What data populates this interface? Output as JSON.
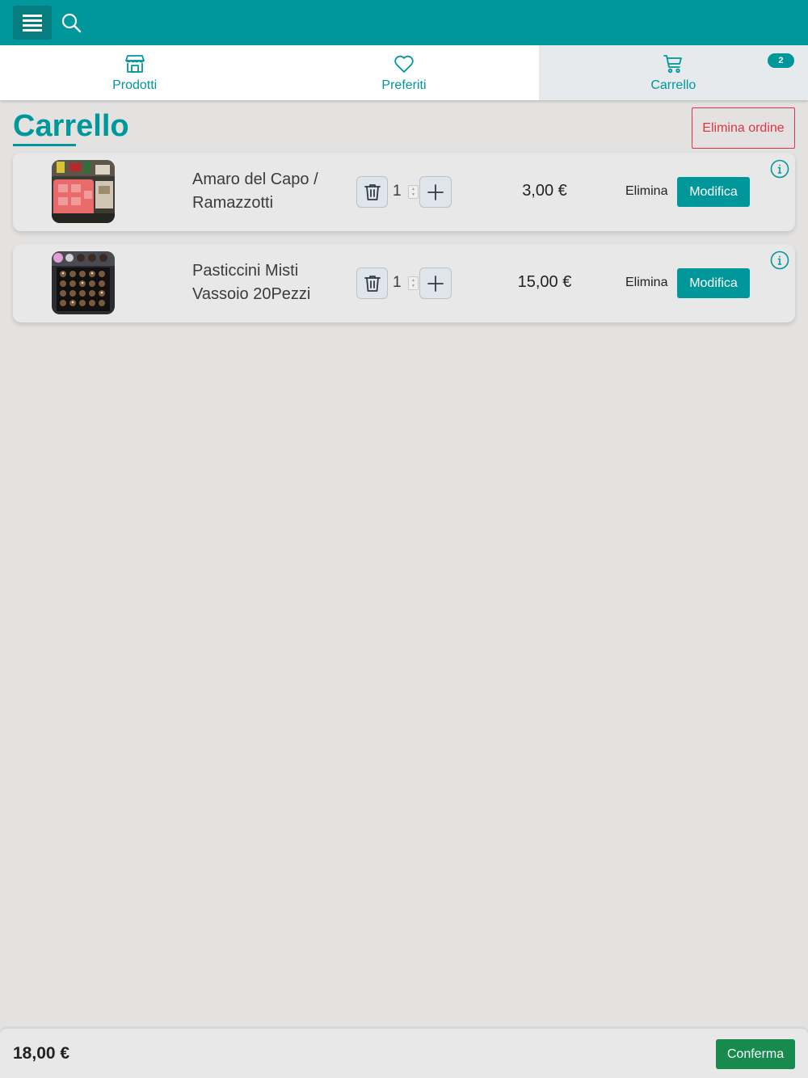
{
  "header": {
    "menu_icon": "hamburger-icon",
    "search_icon": "search-icon",
    "brand_color": "#00979a"
  },
  "tabs": [
    {
      "label": "Prodotti",
      "icon": "store-icon"
    },
    {
      "label": "Preferiti",
      "icon": "heart-icon"
    },
    {
      "label": "Carrello",
      "icon": "cart-icon",
      "badge": "2",
      "active": true
    }
  ],
  "page": {
    "title": "Carrello",
    "delete_order_label": "Elimina ordine"
  },
  "items": [
    {
      "name": "Amaro del Capo / Ramazzotti",
      "quantity": "1",
      "price": "3,00 €",
      "delete_label": "Elimina",
      "edit_label": "Modifica"
    },
    {
      "name": "Pasticcini Misti Vassoio 20Pezzi",
      "quantity": "1",
      "price": "15,00 €",
      "delete_label": "Elimina",
      "edit_label": "Modifica"
    }
  ],
  "footer": {
    "total": "18,00 €",
    "confirm_label": "Conferma"
  },
  "colors": {
    "accent": "#00979a",
    "danger": "#dc3545",
    "confirm": "#178a4e"
  }
}
